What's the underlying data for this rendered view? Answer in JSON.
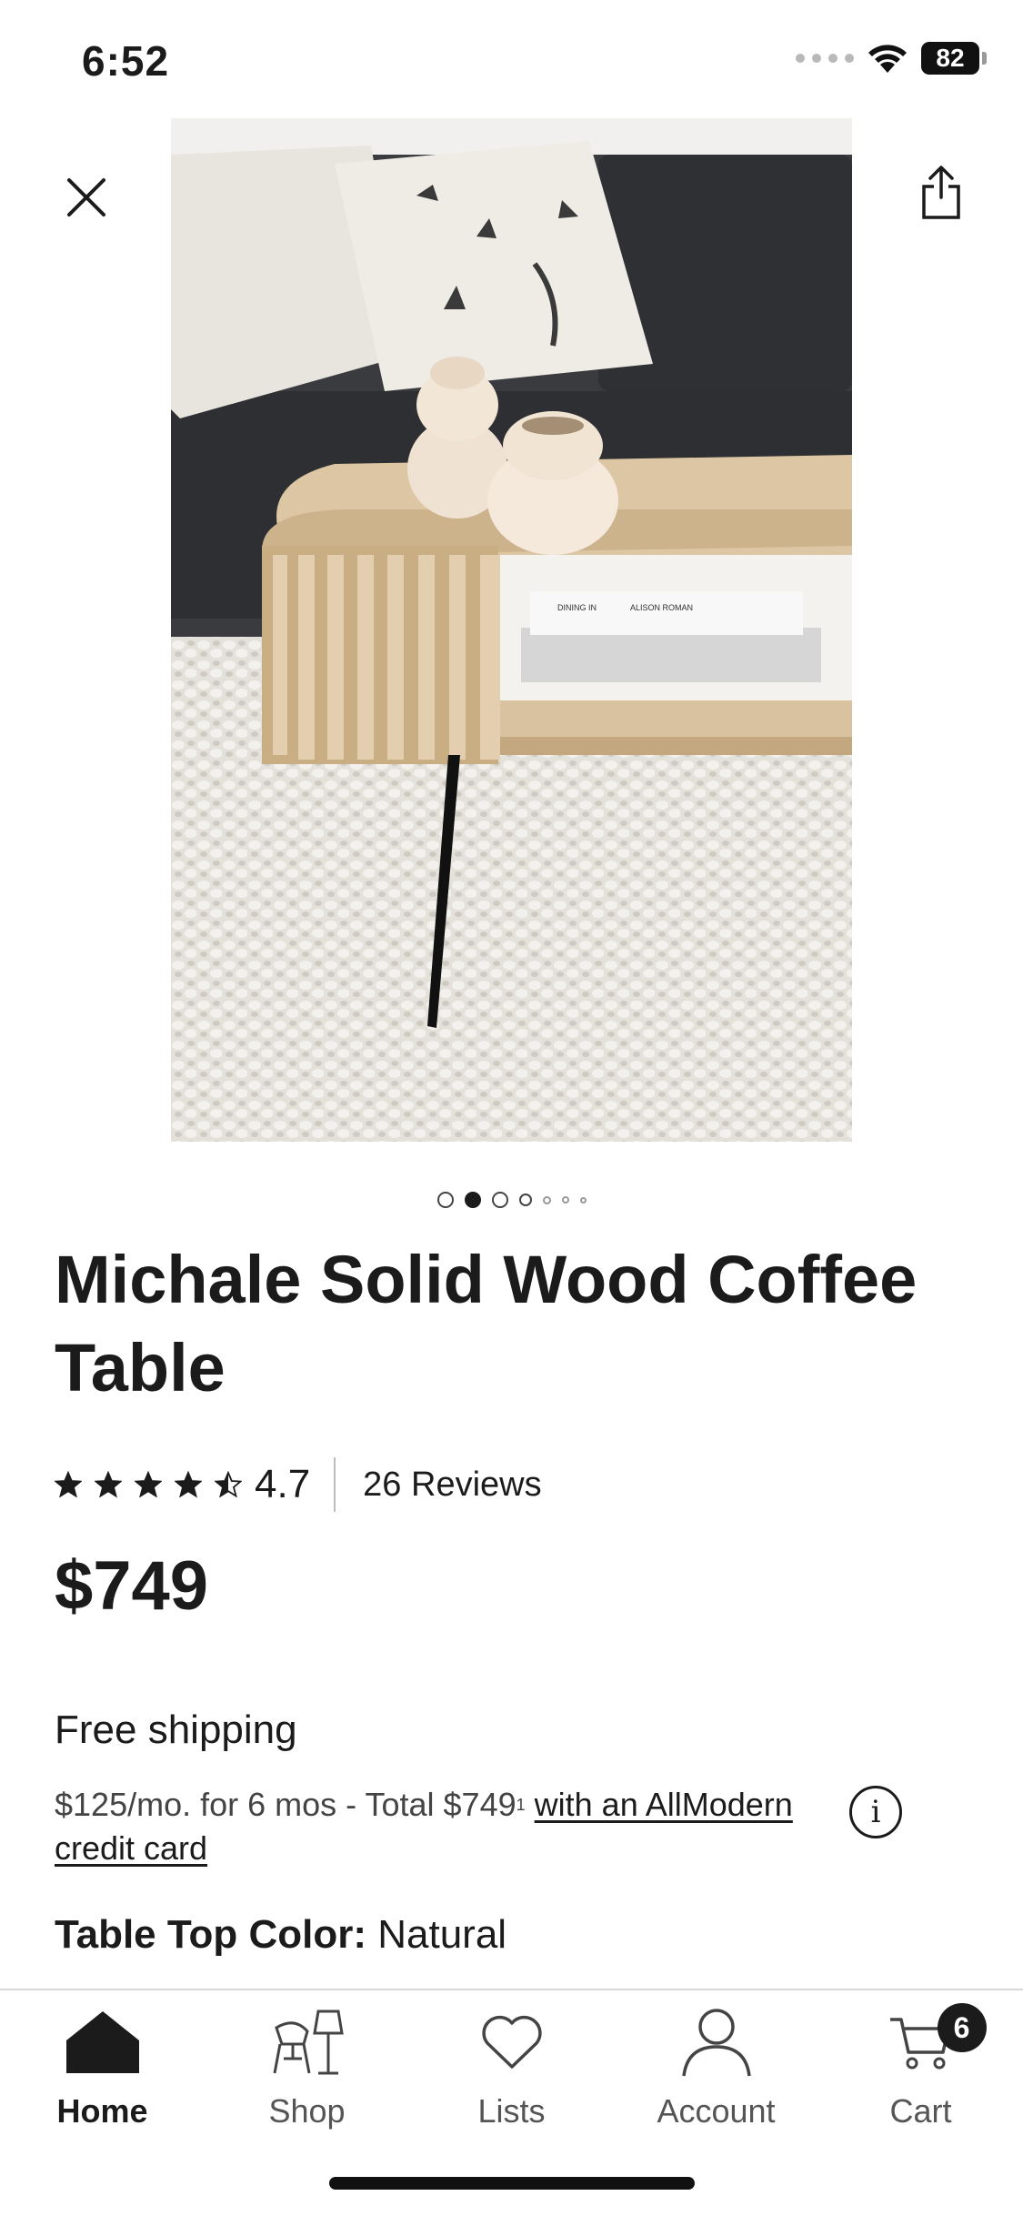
{
  "status_bar": {
    "time": "6:52",
    "battery": "82"
  },
  "gallery": {
    "image_count": 7,
    "active_index": 1,
    "book_text_1": "DINING IN",
    "book_text_2": "ALISON ROMAN",
    "colors": {
      "sofa": "#38393c",
      "wood": "#d9c2a0",
      "rug": "#e3e0da",
      "pillow": "#eeebe5"
    }
  },
  "product": {
    "title": "Michale Solid Wood Coffee Table",
    "rating": "4.7",
    "rating_stars": 4.5,
    "reviews": "26 Reviews",
    "price": "$749",
    "shipping": "Free shipping",
    "finance_text": "$125/mo. for 6 mos - Total $749",
    "finance_sup": "1",
    "finance_link": "with an AllModern credit card",
    "option_label": "Table Top Color:",
    "option_value": "Natural"
  },
  "nav": {
    "items": [
      {
        "label": "Home",
        "icon": "home-icon",
        "active": true
      },
      {
        "label": "Shop",
        "icon": "chair-lamp-icon",
        "active": false
      },
      {
        "label": "Lists",
        "icon": "heart-icon",
        "active": false
      },
      {
        "label": "Account",
        "icon": "person-icon",
        "active": false
      },
      {
        "label": "Cart",
        "icon": "cart-icon",
        "active": false
      }
    ],
    "cart_count": "6"
  }
}
